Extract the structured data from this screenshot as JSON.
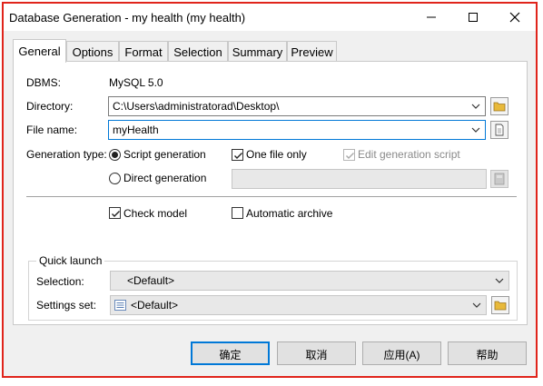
{
  "window": {
    "title": "Database Generation - my health (my health)",
    "minimize_icon": "minimize-icon",
    "maximize_icon": "maximize-icon",
    "close_icon": "close-icon"
  },
  "tabs": [
    {
      "label": "General",
      "active": true
    },
    {
      "label": "Options",
      "active": false
    },
    {
      "label": "Format",
      "active": false
    },
    {
      "label": "Selection",
      "active": false
    },
    {
      "label": "Summary",
      "active": false
    },
    {
      "label": "Preview",
      "active": false
    }
  ],
  "general": {
    "dbms_label": "DBMS:",
    "dbms_value": "MySQL 5.0",
    "directory_label": "Directory:",
    "directory_value": "C:\\Users\\administratorad\\Desktop\\",
    "filename_label": "File name:",
    "filename_value": "myHealth",
    "gentype_label": "Generation type:",
    "script_generation": "Script generation",
    "direct_generation": "Direct generation",
    "one_file_only": "One file only",
    "edit_generation_script": "Edit generation script",
    "check_model": "Check model",
    "automatic_archive": "Automatic archive",
    "states": {
      "script_generation_selected": true,
      "one_file_only_checked": true,
      "edit_generation_script_checked": true,
      "check_model_checked": true,
      "automatic_archive_checked": false
    }
  },
  "quick_launch": {
    "title": "Quick launch",
    "selection_label": "Selection:",
    "selection_value": "<Default>",
    "settings_label": "Settings set:",
    "settings_value": "<Default>"
  },
  "buttons": {
    "ok": "确定",
    "cancel": "取消",
    "apply": "应用(A)",
    "help": "帮助"
  },
  "colors": {
    "frame_border": "#e0241b",
    "focus_blue": "#0078d7",
    "folder_yellow": "#e8b93a"
  }
}
